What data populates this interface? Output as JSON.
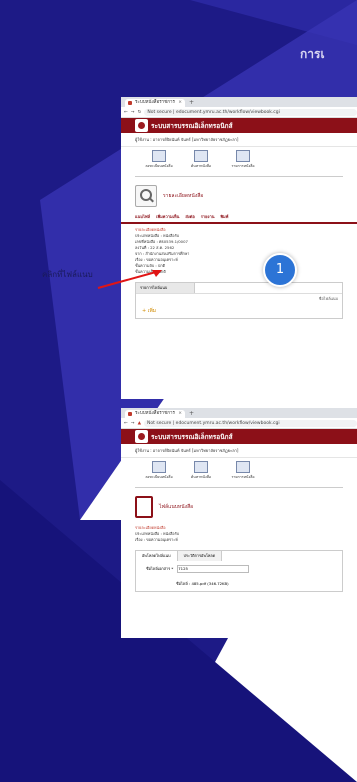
{
  "slide": {
    "title": "การเ",
    "callout_label": "คลิกที่ไฟล์แนบ",
    "step_number": "1",
    "colors": {
      "background": "#1d1a86",
      "app_header": "#8c1018",
      "step_circle": "#2c74d6"
    }
  },
  "browser": {
    "tab_title": "ระบบหนังสือราชการ",
    "address": "Not secure | edocument.ymru.ac.th/workflow/viewbook.cgi"
  },
  "app": {
    "title": "ระบบสารบรรณอิเล็กทรอนิกส์",
    "user_line": "ผู้ใช้งาน : อาจารย์ปิยนันท์ จันทร์ [มหาวิทยาลัยราชภัฏยะลา]",
    "toolbar": [
      "ลงทะเบียนหนังสือ",
      "ค้นหาหนังสือ",
      "รายการหนังสือ"
    ]
  },
  "screen_one": {
    "page_title": "รายละเอียดหนังสือ",
    "menu": [
      "แนบไฟล์",
      "เพิ่มความเห็น",
      "ส่งต่อ",
      "รายงาน",
      "พิมพ์"
    ],
    "info_header": "รายละเอียดหนังสือ",
    "info_lines": [
      "ประเภทหนังสือ : หนังสือรับ",
      "เลขที่หนังสือ : ศธ0539.1/0007",
      "ลงวันที่ : 22 ส.ค. 2562",
      "จาก : สำนักงานส่งเสริมการศึกษา",
      "เรื่อง : ขอความอนุเคราะห์",
      "ชั้นความลับ : ปกติ",
      "ชั้นความเร็ว : ปกติ"
    ],
    "attach_header": "รายการไฟล์แนบ",
    "attach_col": "ชื่อไฟล์แนบ",
    "attach_add": "+ เพิ่ม"
  },
  "screen_two": {
    "page_title": "ไฟล์แนบหนังสือ",
    "info_lines": [
      "รายละเอียดหนังสือ",
      "ประเภทหนังสือ : หนังสือรับ",
      "เรื่อง : ขอความอนุเคราะห์"
    ],
    "tabs": [
      "อัพโหลดไฟล์แนบ",
      "ประวัติการอัพโหลด"
    ],
    "field_label": "ชื่อไฟล์เอกสาร *",
    "field_value": "7125",
    "file_line": "ชื่อไฟล์ : 485.pdf (346.72KB)"
  }
}
